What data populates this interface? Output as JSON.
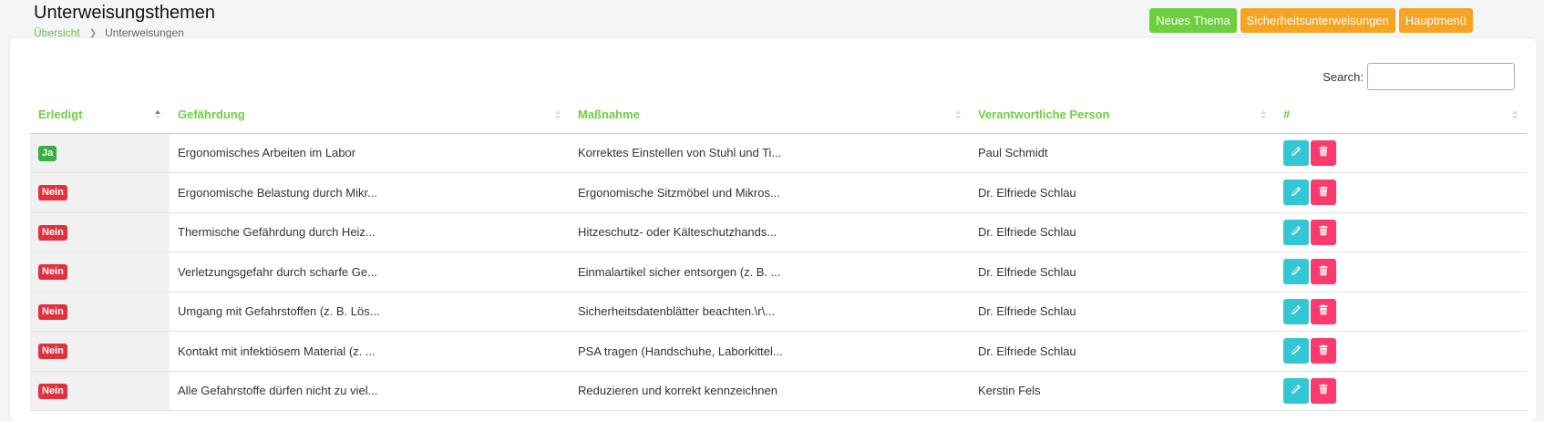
{
  "header": {
    "title": "Unterweisungsthemen",
    "breadcrumb": {
      "home": "Übersicht",
      "current": "Unterweisungen"
    }
  },
  "actions": {
    "new_topic": "Neues Thema",
    "safety_instructions": "Sicherheitsunterweisungen",
    "main_menu": "Hauptmenü"
  },
  "search": {
    "label": "Search:",
    "value": "",
    "placeholder": ""
  },
  "table": {
    "headers": {
      "done": "Erledigt",
      "hazard": "Gefährdung",
      "measure": "Maßnahme",
      "person": "Verantwortliche Person",
      "actions": "#"
    },
    "rows": [
      {
        "done": "Ja",
        "hazard": "Ergonomisches Arbeiten im Labor",
        "measure": "Korrektes Einstellen von Stuhl und Ti...",
        "person": "Paul Schmidt"
      },
      {
        "done": "Nein",
        "hazard": "Ergonomische Belastung durch Mikr...",
        "measure": "Ergonomische Sitzmöbel und Mikros...",
        "person": "Dr. Elfriede Schlau"
      },
      {
        "done": "Nein",
        "hazard": "Thermische Gefährdung durch Heiz...",
        "measure": "Hitzeschutz- oder Kälteschutzhands...",
        "person": "Dr. Elfriede Schlau"
      },
      {
        "done": "Nein",
        "hazard": "Verletzungsgefahr durch scharfe Ge...",
        "measure": "Einmalartikel sicher entsorgen (z. B. ...",
        "person": "Dr. Elfriede Schlau"
      },
      {
        "done": "Nein",
        "hazard": "Umgang mit Gefahrstoffen (z. B. Lös...",
        "measure": "Sicherheitsdatenblätter beachten.\\r\\...",
        "person": "Dr. Elfriede Schlau"
      },
      {
        "done": "Nein",
        "hazard": "Kontakt mit infektiösem Material (z. ...",
        "measure": "PSA tragen (Handschuhe, Laborkittel...",
        "person": "Dr. Elfriede Schlau"
      },
      {
        "done": "Nein",
        "hazard": "Alle Gefahrstoffe dürfen nicht zu viel...",
        "measure": "Reduzieren und korrekt kennzeichnen",
        "person": "Kerstin Fels"
      }
    ]
  },
  "icons": {
    "edit": "pencil-icon",
    "delete": "trash-icon",
    "breadcrumb_separator": "chevron-right-icon"
  },
  "colors": {
    "accent": "#6dcf3f",
    "orange": "#f6a424",
    "yes": "#3aae3f",
    "no": "#e0313f",
    "edit": "#33c7d4",
    "delete": "#fb3b6e"
  }
}
